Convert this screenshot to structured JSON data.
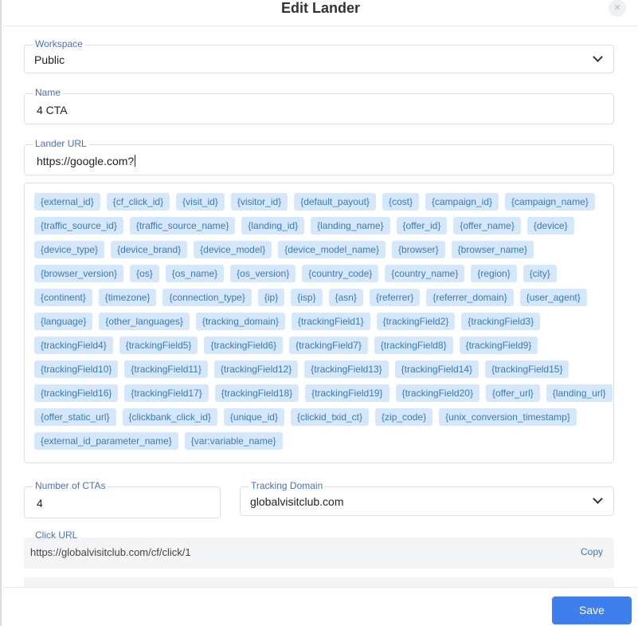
{
  "modal": {
    "title": "Edit Lander",
    "close_icon": "close-icon",
    "close_glyph": "×"
  },
  "workspace": {
    "label": "Workspace",
    "value": "Public"
  },
  "name": {
    "label": "Name",
    "value": "4 CTA"
  },
  "lander_url": {
    "label": "Lander URL",
    "value": "https://google.com?"
  },
  "tokens": [
    "{external_id}",
    "{cf_click_id}",
    "{visit_id}",
    "{visitor_id}",
    "{default_payout}",
    "{cost}",
    "{campaign_id}",
    "{campaign_name}",
    "{traffic_source_id}",
    "{traffic_source_name}",
    "{landing_id}",
    "{landing_name}",
    "{offer_id}",
    "{offer_name}",
    "{device}",
    "{device_type}",
    "{device_brand}",
    "{device_model}",
    "{device_model_name}",
    "{browser}",
    "{browser_name}",
    "{browser_version}",
    "{os}",
    "{os_name}",
    "{os_version}",
    "{country_code}",
    "{country_name}",
    "{region}",
    "{city}",
    "{continent}",
    "{timezone}",
    "{connection_type}",
    "{ip}",
    "{isp}",
    "{asn}",
    "{referrer}",
    "{referrer_domain}",
    "{user_agent}",
    "{language}",
    "{other_languages}",
    "{tracking_domain}",
    "{trackingField1}",
    "{trackingField2}",
    "{trackingField3}",
    "{trackingField4}",
    "{trackingField5}",
    "{trackingField6}",
    "{trackingField7}",
    "{trackingField8}",
    "{trackingField9}",
    "{trackingField10}",
    "{trackingField11}",
    "{trackingField12}",
    "{trackingField13}",
    "{trackingField14}",
    "{trackingField15}",
    "{trackingField16}",
    "{trackingField17}",
    "{trackingField18}",
    "{trackingField19}",
    "{trackingField20}",
    "{offer_url}",
    "{landing_url}",
    "{offer_static_url}",
    "{clickbank_click_id}",
    "{unique_id}",
    "{clickid_txid_ct}",
    "{zip_code}",
    "{unix_conversion_timestamp}",
    "{external_id_parameter_name}",
    "{var:variable_name}"
  ],
  "ctas": {
    "label": "Number of CTAs",
    "value": "4"
  },
  "tracking_domain": {
    "label": "Tracking Domain",
    "value": "globalvisitclub.com"
  },
  "click_url": {
    "label": "Click URL",
    "value": "https://globalvisitclub.com/cf/click/1",
    "copy_label": "Copy"
  },
  "footer": {
    "save_label": "Save"
  },
  "colors": {
    "accent": "#3e7eed",
    "chip_bg": "#d5e8fb",
    "chip_text": "#3b78b5",
    "label": "#4a6fb5"
  }
}
